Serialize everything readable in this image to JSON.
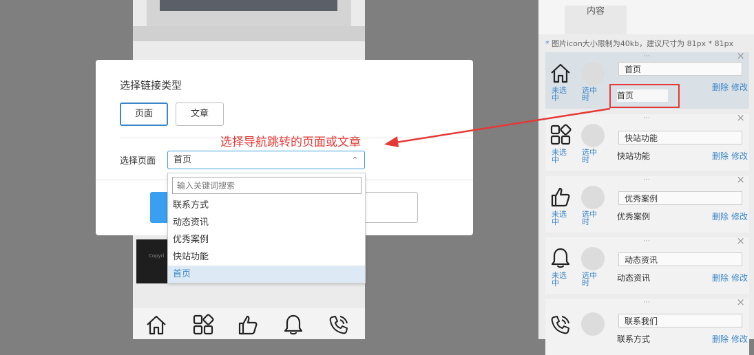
{
  "right_panel": {
    "tab_label": "内容",
    "note_star": "*",
    "note_text": " 图片icon大小限制为40kb，建议尺寸为 81px * 81px",
    "drag_handle": "⋯",
    "close_glyph": "×",
    "unselected_label": "未选中",
    "selected_label": "选中时",
    "delete_label": "删除",
    "edit_label": "修改",
    "items": [
      {
        "icon": "home-icon",
        "input_value": "首页",
        "link_text": "首页"
      },
      {
        "icon": "apps-icon",
        "input_value": "快站功能",
        "link_text": "快站功能"
      },
      {
        "icon": "thumbs-up-icon",
        "input_value": "优秀案例",
        "link_text": "优秀案例"
      },
      {
        "icon": "bell-icon",
        "input_value": "动态资讯",
        "link_text": "动态资讯"
      },
      {
        "icon": "phone-icon",
        "input_value": "联系我们",
        "link_text": "联系方式"
      }
    ]
  },
  "modal": {
    "title": "选择链接类型",
    "type_buttons": [
      "页面",
      "文章"
    ],
    "active_type": "页面",
    "select_label": "选择页面",
    "select_value": "首页",
    "dropdown": {
      "search_placeholder": "输入关键词搜索",
      "options": [
        "联系方式",
        "动态资讯",
        "优秀案例",
        "快站功能",
        "首页"
      ],
      "selected": "首页"
    }
  },
  "annotation": {
    "text": "选择导航跳转的页面或文章",
    "color": "#e53935"
  },
  "phone_preview": {
    "footer_text": "Copyri",
    "nav_icons": [
      "home-icon",
      "apps-icon",
      "thumbs-up-icon",
      "bell-icon",
      "phone-icon"
    ]
  },
  "colors": {
    "accent": "#3a86c8",
    "primary_button": "#3a9ff0",
    "highlight": "#e53935"
  }
}
